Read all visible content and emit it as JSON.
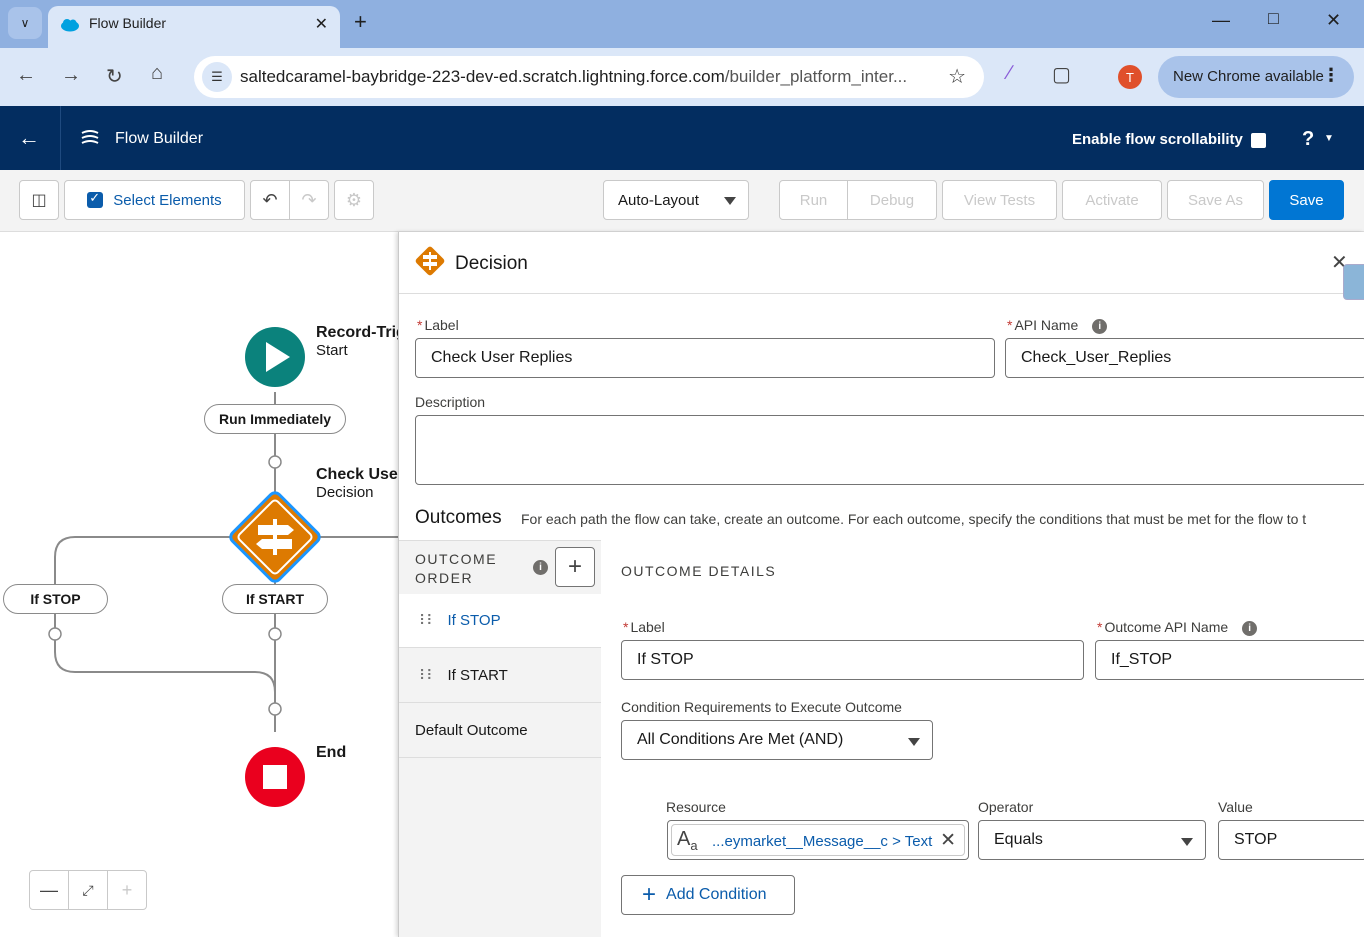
{
  "browser": {
    "tab_title": "Flow Builder",
    "url_host": "saltedcaramel-baybridge-223-dev-ed.scratch.lightning.force.com",
    "url_path": "/builder_platform_inter...",
    "avatar_letter": "T",
    "update_label": "New Chrome available"
  },
  "header": {
    "app_title": "Flow Builder",
    "scroll_label": "Enable flow scrollability",
    "help": "?"
  },
  "toolbar": {
    "select_elements": "Select Elements",
    "layout": "Auto-Layout",
    "run": "Run",
    "debug": "Debug",
    "view_tests": "View Tests",
    "activate": "Activate",
    "save_as": "Save As",
    "save": "Save"
  },
  "canvas": {
    "start_title": "Record-Trig",
    "start_sub": "Start",
    "run_immediately": "Run Immediately",
    "decision_title": "Check User",
    "decision_sub": "Decision",
    "branch_stop": "If STOP",
    "branch_start": "If START",
    "end_label": "End"
  },
  "panel": {
    "title": "Decision",
    "label_field": "Label",
    "label_value": "Check User Replies",
    "api_field": "API Name",
    "api_value": "Check_User_Replies",
    "description_field": "Description",
    "outcomes_title": "Outcomes",
    "outcomes_desc": "For each path the flow can take, create an outcome. For each outcome, specify the conditions that must be met for the flow to t",
    "order_title_1": "OUTCOME",
    "order_title_2": "ORDER",
    "outcomes": [
      {
        "label": "If STOP"
      },
      {
        "label": "If START"
      },
      {
        "label": "Default Outcome"
      }
    ],
    "details_title": "OUTCOME DETAILS",
    "outcome_label_field": "Label",
    "outcome_label_value": "If STOP",
    "outcome_api_field": "Outcome API Name",
    "outcome_api_value": "If_STOP",
    "cond_req_field": "Condition Requirements to Execute Outcome",
    "cond_req_value": "All Conditions Are Met (AND)",
    "resource_field": "Resource",
    "resource_value": "...eymarket__Message__c > Text",
    "operator_field": "Operator",
    "operator_value": "Equals",
    "value_field": "Value",
    "value_value": "STOP",
    "add_condition": "Add Condition"
  },
  "colors": {
    "header_bg": "#032d60",
    "brand_blue": "#0176d3",
    "start_green": "#0b827c",
    "decision_orange": "#dd7a01",
    "end_red": "#ea001e"
  }
}
